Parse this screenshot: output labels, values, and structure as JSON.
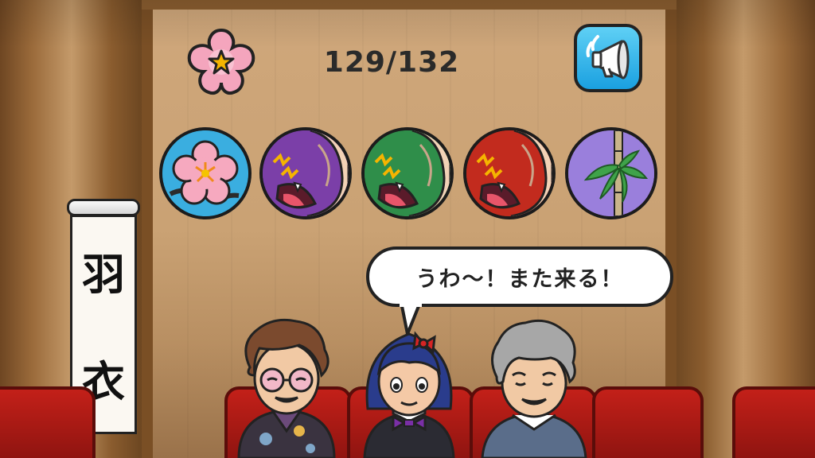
{
  "hud": {
    "counter": "129/132",
    "flower_button_icon": "star-flower-icon",
    "sound_button_icon": "megaphone-icon"
  },
  "items": [
    {
      "icon": "plum-blossom-icon",
      "color": "#2aa3d8"
    },
    {
      "icon": "purple-monster-mouth-icon",
      "color": "#7b3fa8"
    },
    {
      "icon": "green-monster-mouth-icon",
      "color": "#2f8e4a"
    },
    {
      "icon": "red-monster-mouth-icon",
      "color": "#c22b1e"
    },
    {
      "icon": "bamboo-icon",
      "color": "#8f6fd1"
    }
  ],
  "scroll": {
    "char1": "羽",
    "char2": "衣"
  },
  "dialogue": {
    "text": "うわ〜！また来る！"
  },
  "characters": [
    {
      "name": "left-character"
    },
    {
      "name": "middle-character"
    },
    {
      "name": "right-character"
    }
  ]
}
